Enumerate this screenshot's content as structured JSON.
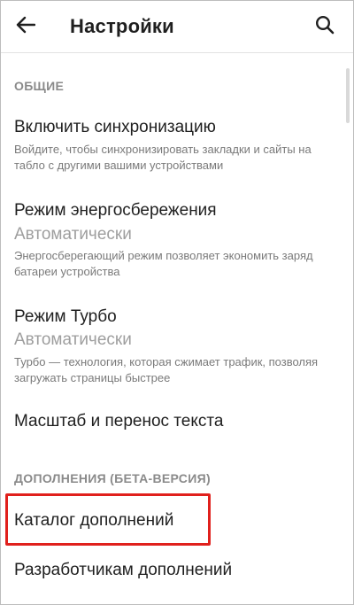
{
  "header": {
    "title": "Настройки",
    "back_icon": "arrow-left-icon",
    "search_icon": "search-icon"
  },
  "sections": {
    "general": {
      "label": "ОБЩИЕ",
      "sync": {
        "title": "Включить синхронизацию",
        "description": "Войдите, чтобы синхронизировать закладки и сайты на табло с другими вашими устройствами"
      },
      "power_save": {
        "title": "Режим энергосбережения",
        "value": "Автоматически",
        "description": "Энергосберегающий режим позволяет экономить заряд батареи устройства"
      },
      "turbo": {
        "title": "Режим Турбо",
        "value": "Автоматически",
        "description": "Турбо — технология, которая сжимает трафик, позволяя загружать страницы быстрее"
      },
      "text_scale": {
        "title": "Масштаб и перенос текста"
      }
    },
    "addons": {
      "label": "ДОПОЛНЕНИЯ (БЕТА-ВЕРСИЯ)",
      "catalog": {
        "title": "Каталог дополнений"
      },
      "developers": {
        "title": "Разработчикам дополнений"
      }
    }
  },
  "colors": {
    "highlight": "#e0201c",
    "section_header": "#8a8a8a",
    "secondary_text": "#9e9e9e"
  }
}
